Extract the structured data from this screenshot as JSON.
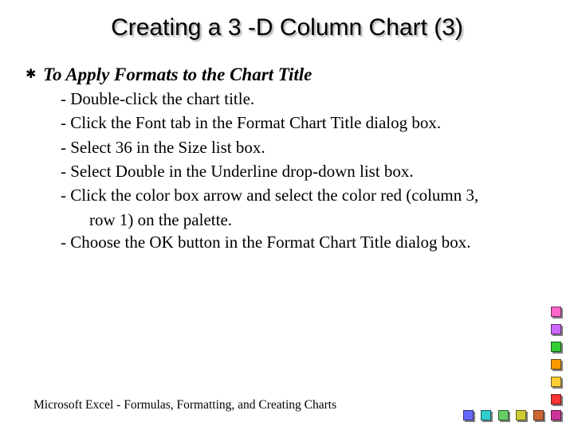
{
  "title": "Creating a 3 -D Column Chart (3)",
  "section_heading": "To Apply  Formats to the Chart Title",
  "steps": {
    "s1": "- Double-click the chart title.",
    "s2": "- Click the Font tab in the Format Chart Title dialog box.",
    "s3": "- Select 36 in the Size list box.",
    "s4": "- Select Double in the Underline drop-down list box.",
    "s5a": "-  Click the color box arrow and select the color red (column 3,",
    "s5b": "row 1) on the palette.",
    "s6": "- Choose the OK button in the Format Chart Title dialog box."
  },
  "footer": "Microsoft  Excel - Formulas, Formatting, and Creating Charts",
  "deco_colors": {
    "c1": "#ff66cc",
    "c2": "#cc66ff",
    "c3": "#33cc33",
    "c4": "#ff9900",
    "c5": "#ffcc33",
    "c6": "#ff3333",
    "c7": "#6666ff",
    "c8": "#33cccc",
    "c9": "#66cc66",
    "c10": "#cccc33",
    "c11": "#cc6633",
    "c12": "#cc3399"
  }
}
